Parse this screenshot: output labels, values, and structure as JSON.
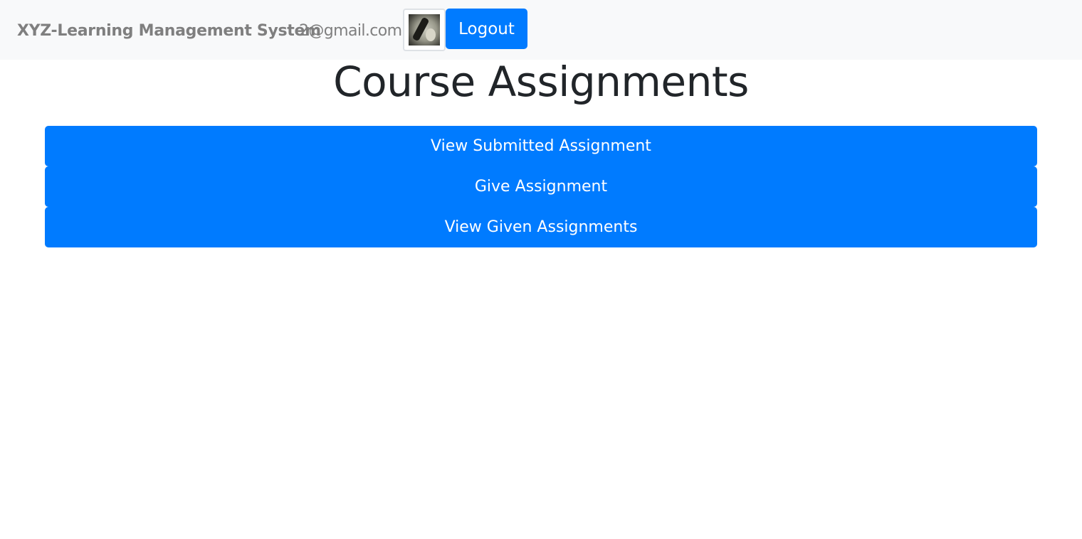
{
  "navbar": {
    "brand": "XYZ-Learning Management System",
    "user_email": "2@gmail.com",
    "logout_label": "Logout"
  },
  "main": {
    "title": "Course Assignments",
    "actions": [
      {
        "label": "View Submitted Assignment"
      },
      {
        "label": "Give Assignment"
      },
      {
        "label": "View Given Assignments"
      }
    ]
  },
  "colors": {
    "primary": "#007bff",
    "navbar_bg": "#f8f9fa",
    "muted_text": "#7f7f7f",
    "heading_text": "#212529"
  }
}
